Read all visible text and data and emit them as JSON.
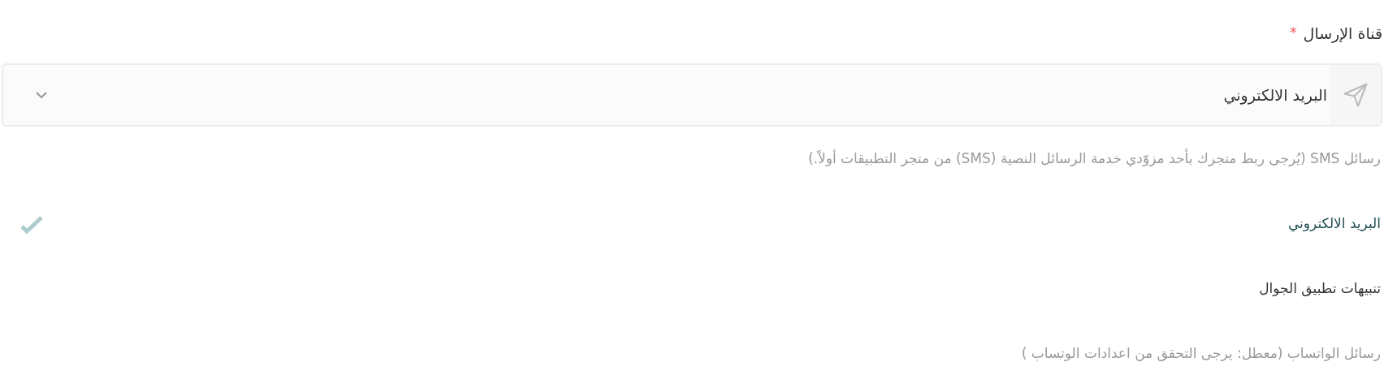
{
  "field": {
    "label": "قناة الإرسال",
    "required_mark": "*",
    "value": "البريد الالكتروني"
  },
  "options": [
    {
      "label": "رسائل SMS (يُرجى ربط متجرك بأحد مزوّدي خدمة الرسائل النصية (SMS) من متجر التطبيقات أولاً.)",
      "selected": false,
      "disabled": true
    },
    {
      "label": "البريد الالكتروني",
      "selected": true,
      "disabled": false
    },
    {
      "label": "تنبيهات تطبيق الجوال",
      "selected": false,
      "disabled": false
    },
    {
      "label": "رسائل الواتساب (معطل: يرجى التحقق من اعدادات الوتساب )",
      "selected": false,
      "disabled": true
    }
  ]
}
